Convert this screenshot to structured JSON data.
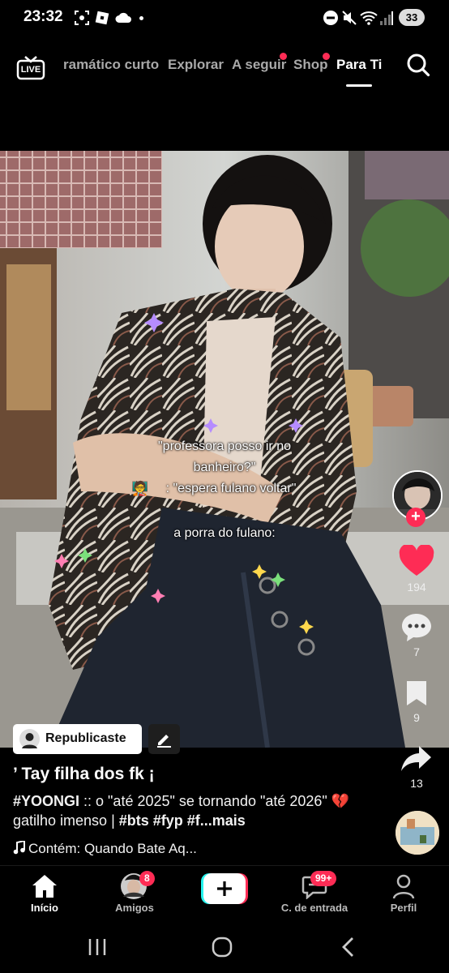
{
  "status_bar": {
    "time": "23:32",
    "battery": "33"
  },
  "top_nav": {
    "live_label": "LIVE",
    "tabs": [
      {
        "label": "ramático curto"
      },
      {
        "label": "Explorar"
      },
      {
        "label": "A seguir"
      },
      {
        "label": "Shop"
      },
      {
        "label": "Para Ti"
      }
    ]
  },
  "video": {
    "caption_lines": [
      "\"professora posso ir no",
      "banheiro?\"",
      ": \"espera fulano voltar\"",
      "a porra do fulano:"
    ]
  },
  "side_rail": {
    "likes": "194",
    "comments": "7",
    "saves": "9",
    "shares": "13"
  },
  "post": {
    "repost_label": "Republicaste",
    "username": "’ Tay filha dos fk ¡",
    "desc_hashtag1": "#YOONGI",
    "desc_text1": " :: o \"até 2025\" se tornando \"até 2026\" ",
    "desc_text2": " gatilho imenso | ",
    "desc_hashtags": "#bts #fyp #f",
    "desc_more": "...mais",
    "music": "Contém: Quando Bate Aq..."
  },
  "bottom_nav": {
    "home": "Início",
    "friends": "Amigos",
    "friends_badge": "8",
    "inbox": "C. de entrada",
    "inbox_badge": "99+",
    "profile": "Perfil"
  },
  "colors": {
    "accent": "#fe2c55",
    "like": "#fe2c55",
    "background": "#000000"
  }
}
